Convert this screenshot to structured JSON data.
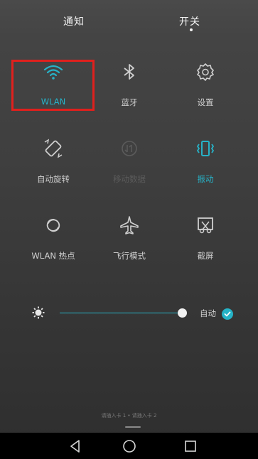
{
  "tabs": {
    "notifications": "通知",
    "toggles": "开关"
  },
  "tiles": [
    {
      "label": "WLAN",
      "state": "on",
      "icon": "wifi-icon"
    },
    {
      "label": "蓝牙",
      "state": "off",
      "icon": "bluetooth-icon"
    },
    {
      "label": "设置",
      "state": "off",
      "icon": "settings-gear-icon"
    },
    {
      "label": "自动旋转",
      "state": "off",
      "icon": "auto-rotate-icon"
    },
    {
      "label": "移动数据",
      "state": "disabled",
      "icon": "mobile-data-icon"
    },
    {
      "label": "振动",
      "state": "on",
      "icon": "vibrate-icon"
    },
    {
      "label": "WLAN 热点",
      "state": "off",
      "icon": "hotspot-icon"
    },
    {
      "label": "飞行模式",
      "state": "off",
      "icon": "airplane-icon"
    },
    {
      "label": "截屏",
      "state": "off",
      "icon": "screenshot-icon"
    }
  ],
  "brightness": {
    "level": 1.0,
    "auto_label": "自动",
    "auto_checked": true
  },
  "sim_status": "请插入卡 1 • 请插入卡 2",
  "colors": {
    "accent": "#27b2c7",
    "highlight": "#e0201d",
    "text": "#cfcfcf"
  },
  "nav": {
    "back": "back-icon",
    "home": "home-icon",
    "recents": "recents-icon"
  }
}
